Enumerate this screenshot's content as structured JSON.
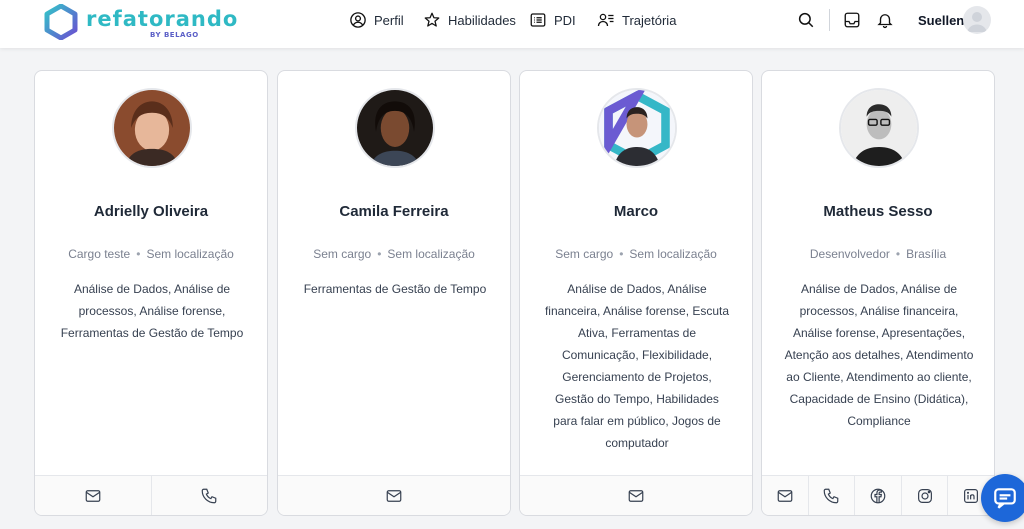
{
  "brand": {
    "name": "refatorando",
    "sub": "BY BELAGO"
  },
  "nav": [
    {
      "label": "Perfil",
      "icon": "user-circle-icon"
    },
    {
      "label": "Habilidades",
      "icon": "star-icon"
    },
    {
      "label": "PDI",
      "icon": "list-icon"
    },
    {
      "label": "Trajetória",
      "icon": "user-list-icon"
    }
  ],
  "header": {
    "username": "Suellen",
    "icons": [
      "search-icon",
      "inbox-icon",
      "bell-icon"
    ]
  },
  "cards": [
    {
      "name": "Adrielly Oliveira",
      "role": "Cargo teste",
      "location": "Sem localização",
      "skills": "Análise de Dados, Análise de processos, Análise forense, Ferramentas de Gestão de Tempo",
      "contacts": [
        "mail-icon",
        "phone-icon"
      ]
    },
    {
      "name": "Camila Ferreira",
      "role": "Sem cargo",
      "location": "Sem localização",
      "skills": "Ferramentas de Gestão de Tempo",
      "contacts": [
        "mail-icon"
      ]
    },
    {
      "name": "Marco",
      "role": "Sem cargo",
      "location": "Sem localização",
      "skills": "Análise de Dados, Análise financeira, Análise forense, Escuta Ativa, Ferramentas de Comunicação, Flexibilidade, Gerenciamento de Projetos, Gestão do Tempo, Habilidades para falar em público, Jogos de computador",
      "contacts": [
        "mail-icon"
      ]
    },
    {
      "name": "Matheus Sesso",
      "role": "Desenvolvedor",
      "location": "Brasília",
      "skills": "Análise de Dados, Análise de processos, Análise financeira, Análise forense, Apresentações, Atenção aos detalhes, Atendimento ao Cliente, Atendimento ao cliente, Capacidade de Ensino (Didática), Compliance",
      "contacts": [
        "mail-icon",
        "phone-icon",
        "facebook-icon",
        "instagram-icon",
        "linkedin-icon"
      ]
    }
  ],
  "colors": {
    "brand_teal": "#2fb9c4",
    "brand_purple": "#5b5fc7",
    "chat_blue": "#1d67d9"
  }
}
